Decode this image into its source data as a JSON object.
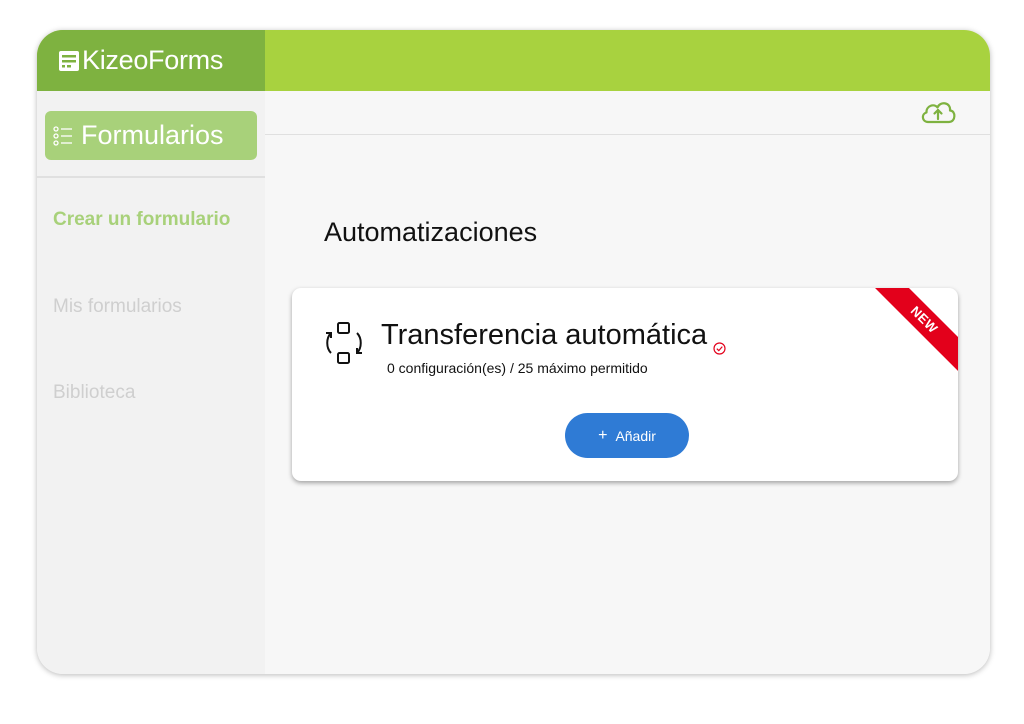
{
  "app": {
    "brand": "KizeoForms"
  },
  "sidebar": {
    "section_label": "Formularios",
    "items": [
      {
        "label": "Crear un formulario",
        "active": true
      },
      {
        "label": "Mis formularios",
        "active": false
      },
      {
        "label": "Biblioteca",
        "active": false
      }
    ]
  },
  "main": {
    "title": "Automatizaciones",
    "card": {
      "title": "Transferencia automática",
      "subtitle": "0 configuración(es) / 25 máximo permitido",
      "ribbon": "NEW",
      "button_icon": "+",
      "button_label": "Añadir"
    }
  },
  "icons": {
    "logo": "form-logo-icon",
    "section": "checklist-icon",
    "upload": "cloud-upload-icon",
    "card": "transfer-icon",
    "status": "check-circle-icon"
  },
  "colors": {
    "topbar": "#a8d23f",
    "logo_bg": "#7eb240",
    "nav_pill": "#a8d17a",
    "button": "#2f7bd5",
    "ribbon": "#e3001b"
  }
}
